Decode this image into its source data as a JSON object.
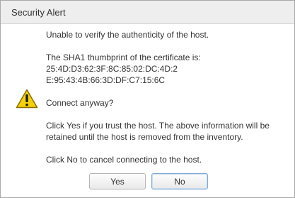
{
  "window": {
    "title": "Security Alert"
  },
  "message": {
    "line1": "Unable to verify the authenticity of the host.",
    "thumbprint_label": "The SHA1 thumbprint of the certificate is:",
    "thumbprint_value": "25:4D:D3:62:3F:8C:85:02:DC:4D:2E:95:43:4B:66:3D:DF:C7:15:6C",
    "question": "Connect anyway?",
    "yes_info": "Click Yes if you trust the host. The above information will be retained until the host is removed from the inventory.",
    "no_info": "Click No to cancel connecting to the host."
  },
  "buttons": {
    "yes_label": "Yes",
    "no_label": "No"
  },
  "icons": {
    "warning": "warning-triangle-icon",
    "close": "close-icon"
  },
  "colors": {
    "warning_fill": "#f5d10a",
    "warning_outline": "#8a6d00",
    "titlebar_bg": "#eeeeee"
  }
}
